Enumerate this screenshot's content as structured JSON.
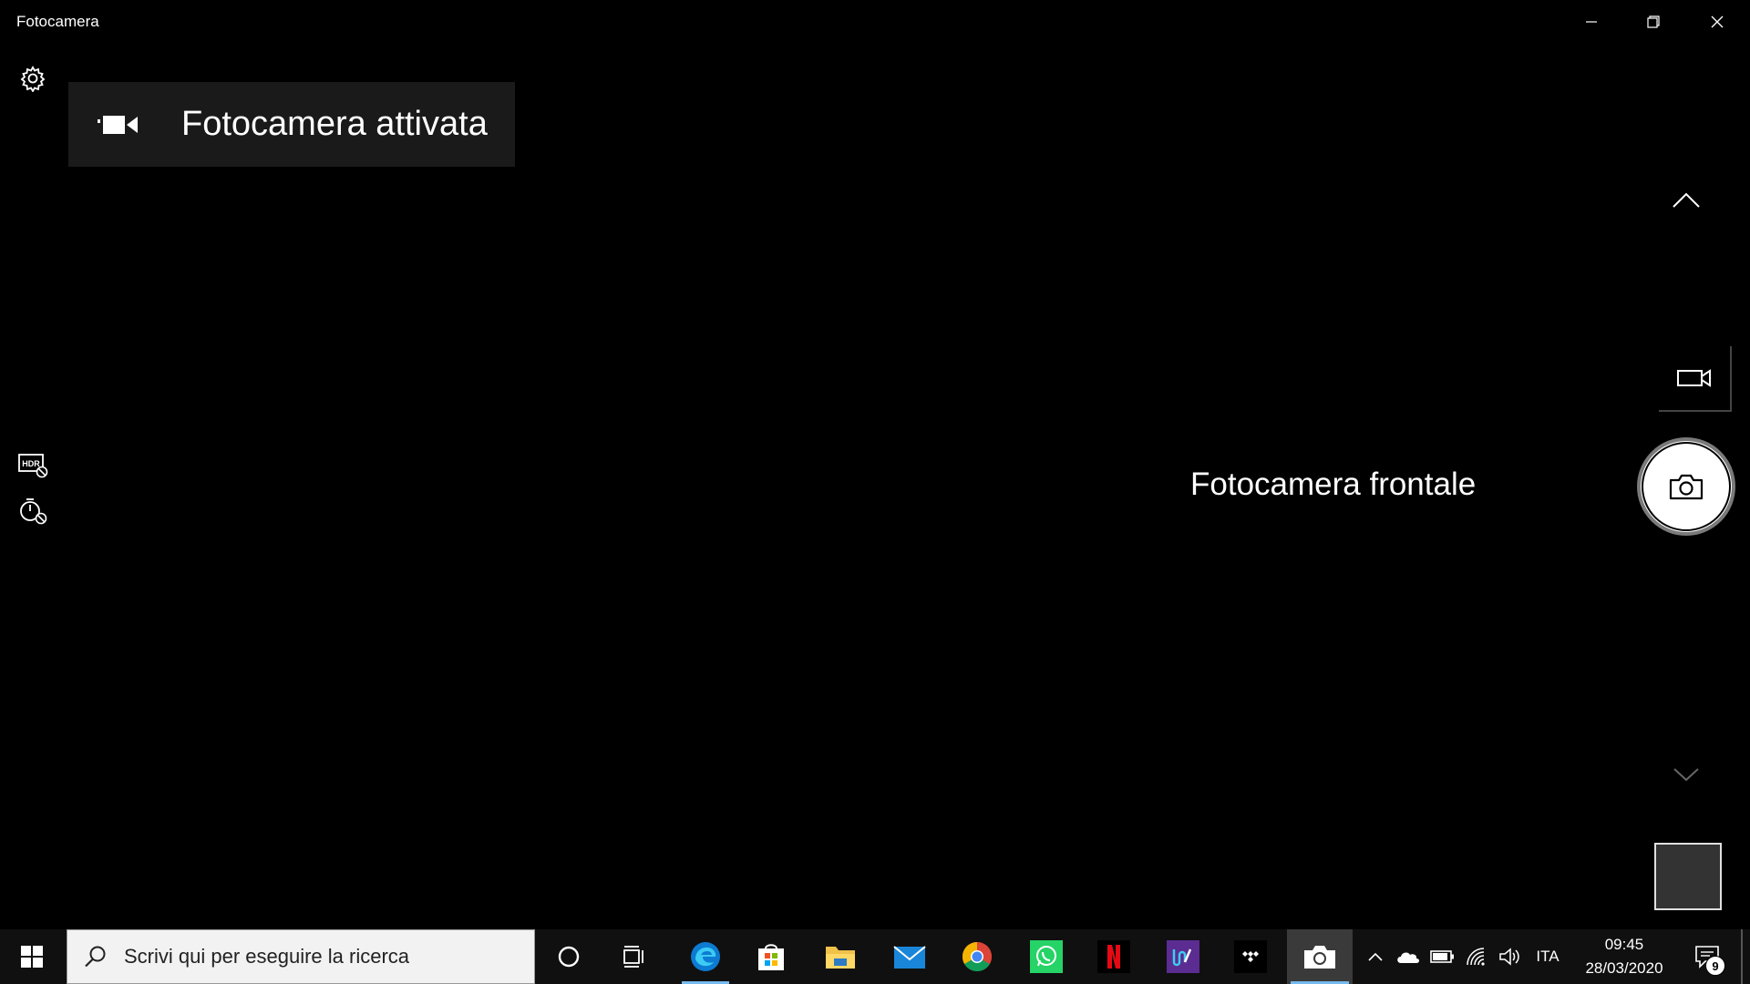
{
  "window": {
    "title": "Fotocamera"
  },
  "toast": {
    "message": "Fotocamera attivata",
    "icon": "video-camera-icon"
  },
  "camera": {
    "switch_label": "Fotocamera frontale",
    "shutter_icon": "camera-icon",
    "video_mode_icon": "video-camera-icon"
  },
  "left_controls": [
    "settings-gear-icon",
    "hdr-off-icon",
    "timer-off-icon"
  ],
  "taskbar": {
    "search_placeholder": "Scrivi qui per eseguire la ricerca",
    "pinned_apps": [
      "cortana-icon",
      "task-view-icon",
      "edge-icon",
      "store-icon",
      "file-explorer-icon",
      "mail-icon",
      "chrome-icon",
      "whatsapp-icon",
      "netflix-icon",
      "purple-app-icon",
      "tidal-icon",
      "camera-app-icon"
    ],
    "tray": {
      "language": "ITA",
      "time": "09:45",
      "date": "28/03/2020",
      "notification_count": "9"
    }
  },
  "colors": {
    "background": "#000000",
    "taskbar": "#101010",
    "toast_bg": "#1a1a1a",
    "active_indicator": "#76b9ed",
    "edge_blue": "#0c7bd1",
    "whatsapp_green": "#25d366",
    "netflix_red": "#e50914",
    "chrome_red": "#db4437",
    "chrome_yellow": "#f4b400",
    "chrome_green": "#0f9d58"
  }
}
